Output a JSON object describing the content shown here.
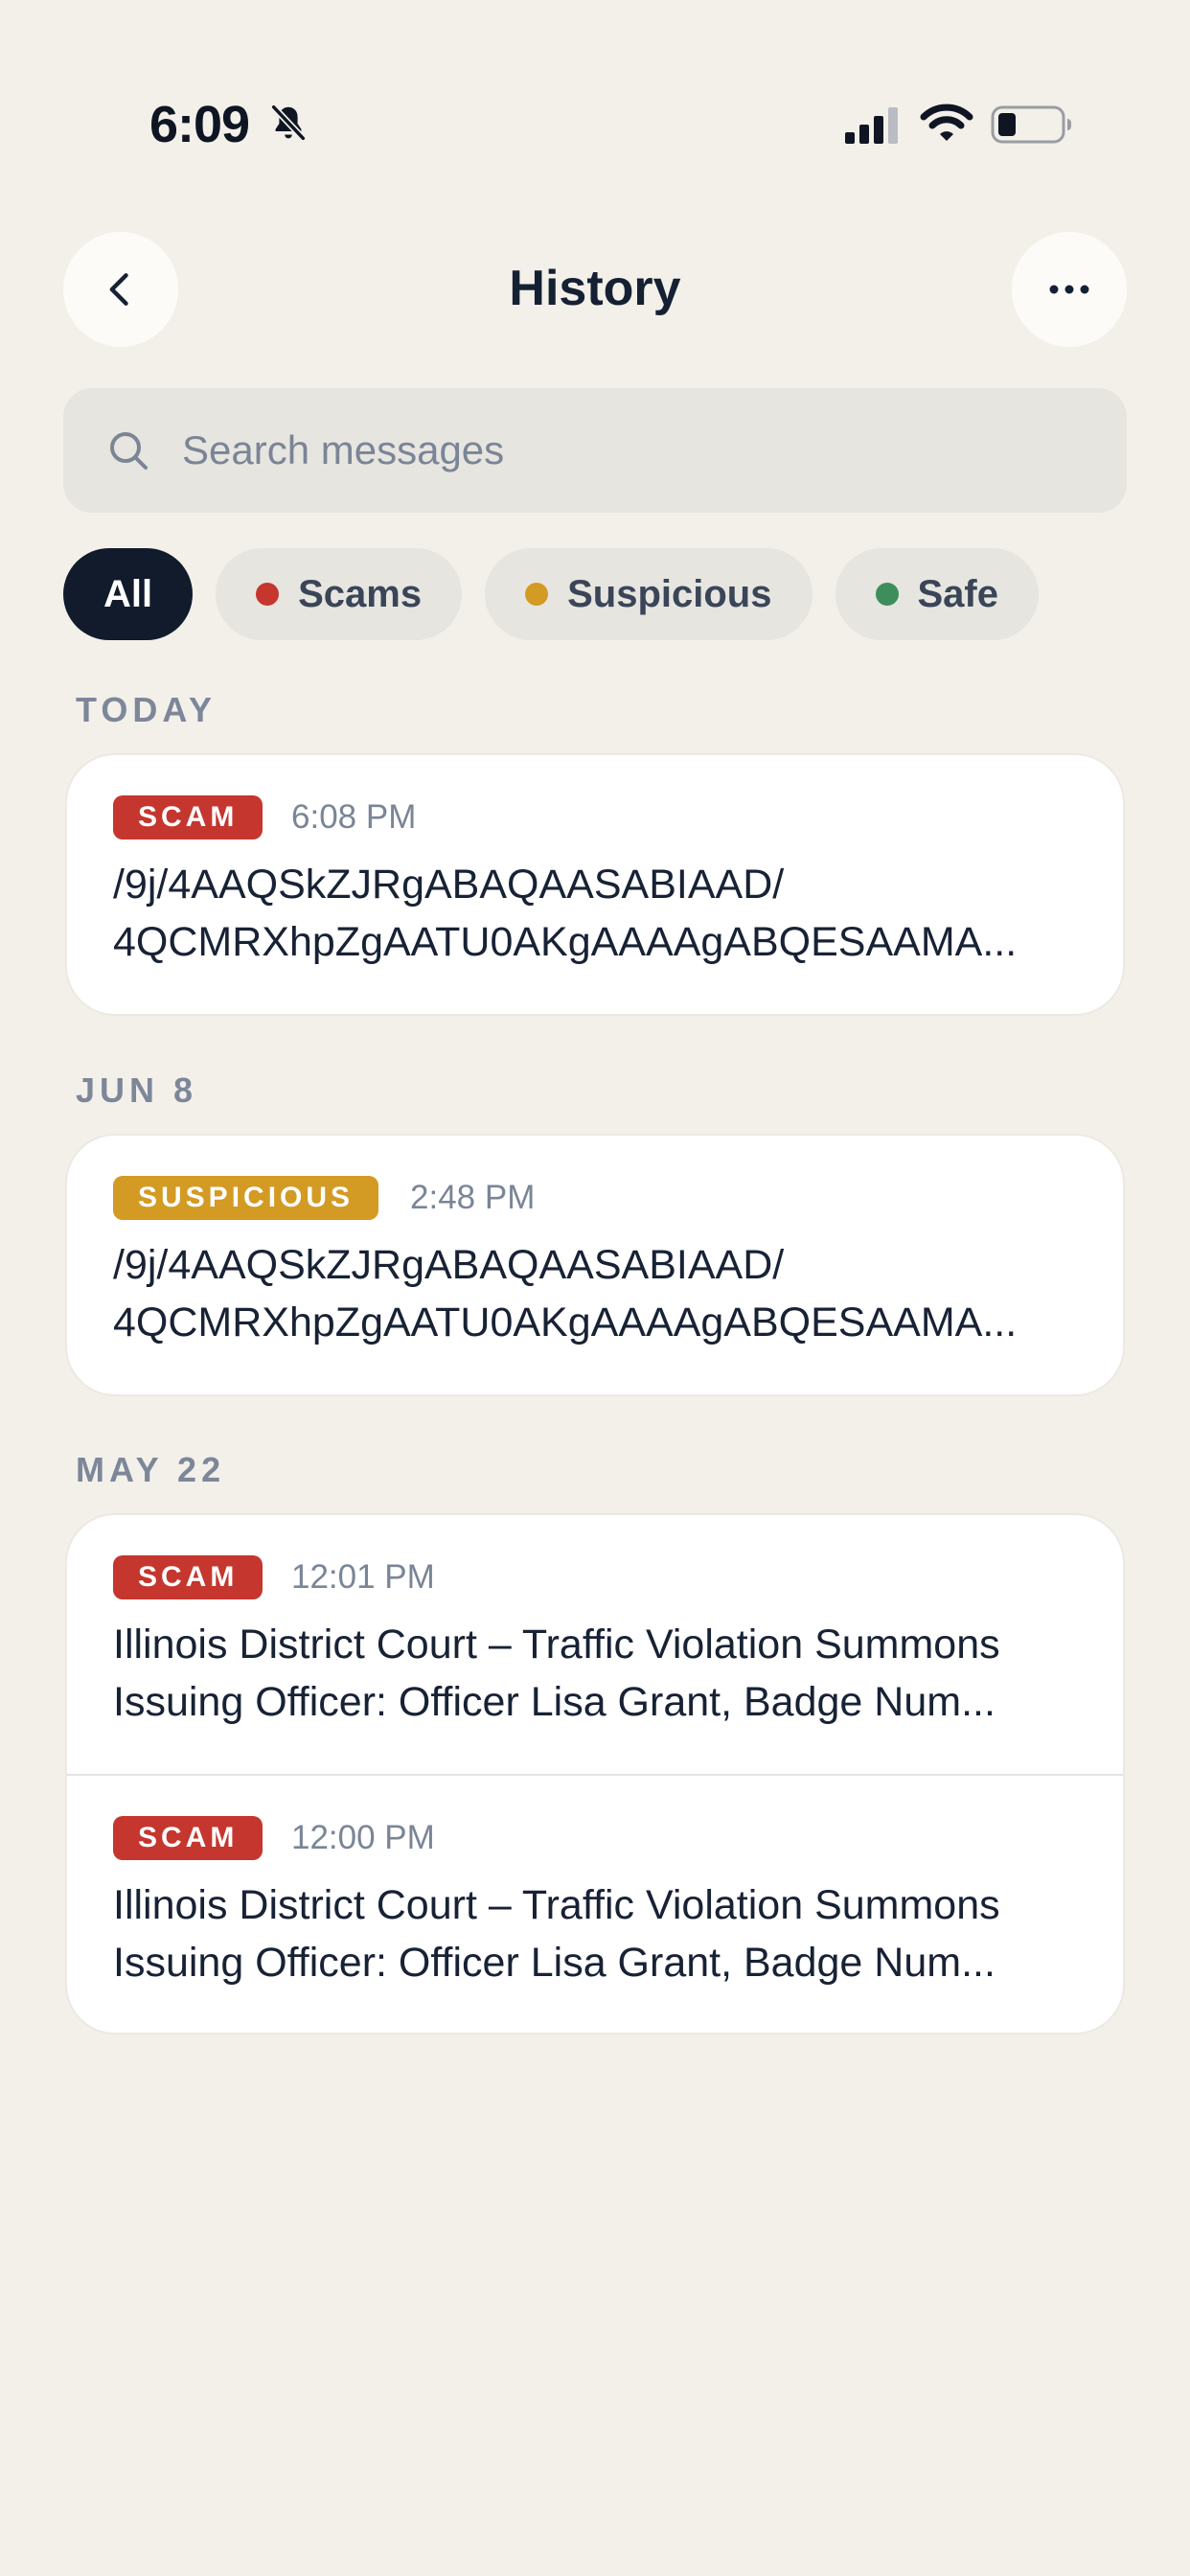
{
  "status_bar": {
    "time": "6:09",
    "icons": [
      "bell-slash-icon",
      "cellular-signal-icon",
      "wifi-icon",
      "battery-icon"
    ]
  },
  "header": {
    "title": "History",
    "back_icon": "chevron-left-icon",
    "more_icon": "ellipsis-icon"
  },
  "search": {
    "placeholder": "Search messages",
    "value": "",
    "icon": "search-icon"
  },
  "filters": [
    {
      "label": "All",
      "active": true
    },
    {
      "label": "Scams",
      "dot_color": "#C5362E"
    },
    {
      "label": "Suspicious",
      "dot_color": "#D39A24"
    },
    {
      "label": "Safe",
      "dot_color": "#3E8E5C"
    }
  ],
  "colors": {
    "scam": "#C5362E",
    "suspicious": "#D39A24",
    "safe": "#3E8E5C",
    "background": "#F3F0EA",
    "active_chip": "#111B2C"
  },
  "sections": [
    {
      "label": "TODAY",
      "items": [
        {
          "badge": "SCAM",
          "time": "6:08 PM",
          "line1": "/9j/4AAQSkZJRgABAQAASABIAAD/",
          "line2": "4QCMRXhpZgAATU0AKgAAAAgABQESAAMA..."
        }
      ]
    },
    {
      "label": "JUN 8",
      "items": [
        {
          "badge": "SUSPICIOUS",
          "time": "2:48 PM",
          "line1": "/9j/4AAQSkZJRgABAQAASABIAAD/",
          "line2": "4QCMRXhpZgAATU0AKgAAAAgABQESAAMA..."
        }
      ]
    },
    {
      "label": "MAY 22",
      "items": [
        {
          "badge": "SCAM",
          "time": "12:01 PM",
          "line1": "Illinois District Court – Traffic Violation Summons",
          "line2": "Issuing Officer: Officer Lisa Grant, Badge Num..."
        },
        {
          "badge": "SCAM",
          "time": "12:00 PM",
          "line1": "Illinois District Court – Traffic Violation Summons",
          "line2": "Issuing Officer: Officer Lisa Grant, Badge Num..."
        }
      ]
    }
  ]
}
